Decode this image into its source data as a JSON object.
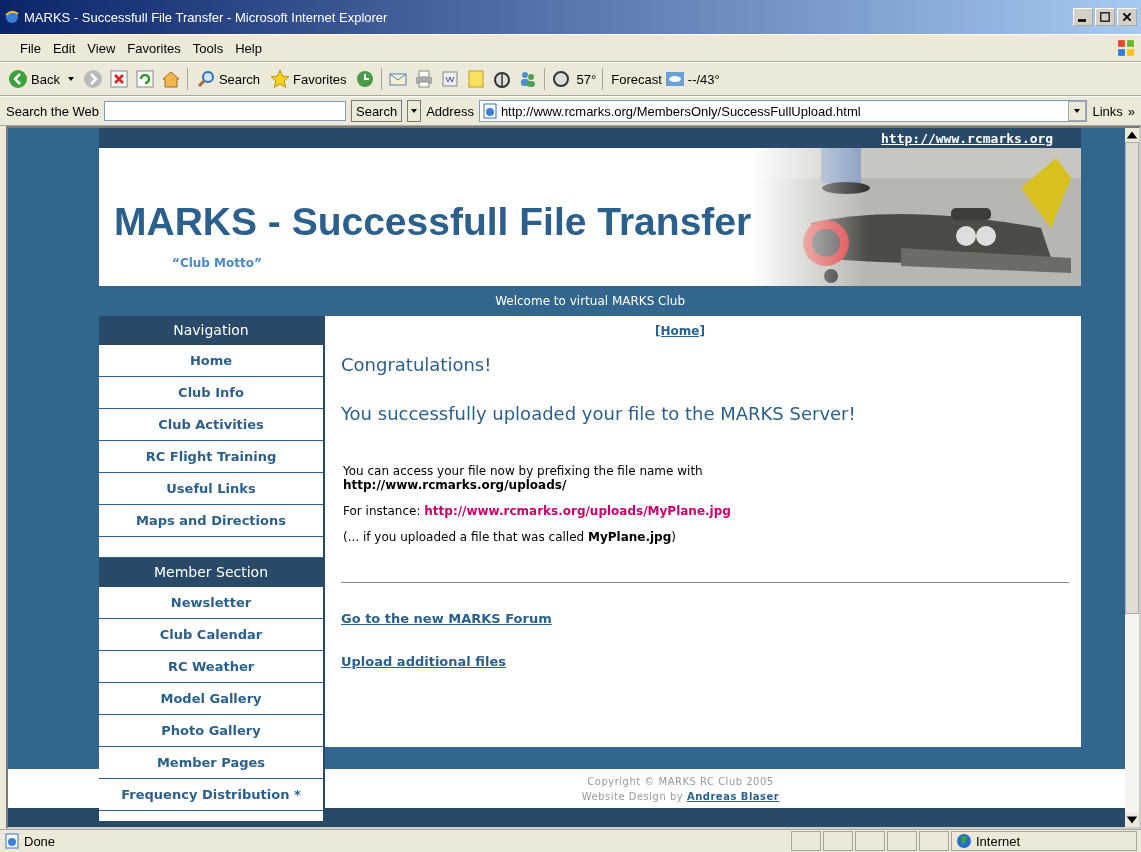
{
  "window": {
    "title": "MARKS - Successfull File Transfer - Microsoft Internet Explorer"
  },
  "menu": [
    "File",
    "Edit",
    "View",
    "Favorites",
    "Tools",
    "Help"
  ],
  "toolbar": {
    "back": "Back",
    "search": "Search",
    "favorites": "Favorites",
    "temperature": "57°",
    "forecast": "Forecast",
    "forecast_value": "--/43°"
  },
  "address_bar": {
    "search_label": "Search the Web",
    "search_button": "Search",
    "address_label": "Address",
    "url": "http://www.rcmarks.org/MembersOnly/SuccessFullUpload.html",
    "links": "Links",
    "links_more": "»"
  },
  "page": {
    "top_link": "http://www.rcmarks.org",
    "heading": "MARKS - Successfull File Transfer",
    "motto": "“Club Motto”",
    "welcome": "Welcome to virtual MARKS Club",
    "sidebar": [
      {
        "title": "Navigation",
        "items": [
          "Home",
          "Club Info",
          "Club Activities",
          "RC Flight Training",
          "Useful Links",
          "Maps and Directions"
        ]
      },
      {
        "title": "Member Section",
        "items": [
          "Newsletter",
          "Club Calendar",
          "RC Weather",
          "Model Gallery",
          "Photo Gallery",
          "Member Pages",
          "Frequency Distribution *"
        ]
      }
    ],
    "home_link": "[Home]",
    "congrats": "Congratulations!",
    "success": "You successfully uploaded your file to the MARKS Server!",
    "access_text": "You can access your file now by prefixing the file name with",
    "prefix_url": "http://www.rcmarks.org/uploads/",
    "instance_label": "For instance:",
    "instance_url": "http://www.rcmarks.org/uploads/MyPlane.jpg",
    "note": "(... if you uploaded a file that was called **MyPlane.jpg**)",
    "links": [
      "Go to the new MARKS Forum",
      "Upload additional files"
    ],
    "copyright": "Copyright © MARKS RC Club 2005",
    "design_by": "Website Design by",
    "designer": "Andreas Blaser"
  },
  "status_bar": {
    "status": "Done",
    "zone": "Internet"
  }
}
